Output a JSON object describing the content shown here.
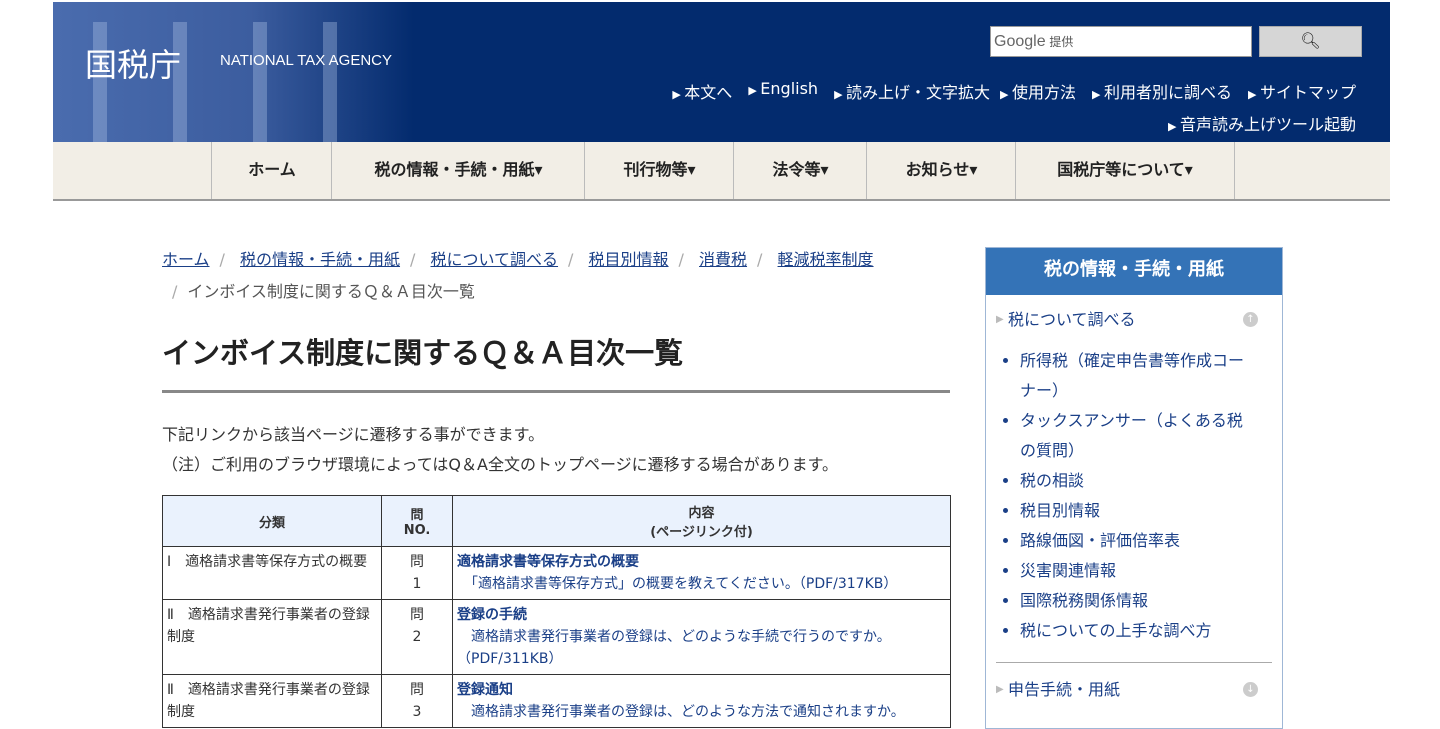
{
  "header": {
    "logo": "国税庁",
    "logo_en": "NATIONAL TAX AGENCY",
    "search_brand": "Google",
    "search_suffix": "提供",
    "search_icon": "search-icon",
    "util_links": [
      "本文へ",
      "English",
      "読み上げ・文字拡大",
      "使用方法",
      "利用者別に調べる",
      "サイトマップ"
    ],
    "util_link2": "音声読み上げツール起動"
  },
  "nav": [
    "ホーム",
    "税の情報・手続・用紙▾",
    "刊行物等▾",
    "法令等▾",
    "お知らせ▾",
    "国税庁等について▾"
  ],
  "breadcrumb": [
    "ホーム",
    "税の情報・手続・用紙",
    "税について調べる",
    "税目別情報",
    "消費税",
    "軽減税率制度"
  ],
  "breadcrumb_current": "インボイス制度に関するＱ＆Ａ目次一覧",
  "page_title": "インボイス制度に関するＱ＆Ａ目次一覧",
  "intro": [
    "下記リンクから該当ページに遷移する事ができます。",
    "（注）ご利用のブラウザ環境によってはQ＆A全文のトップページに遷移する場合があります。"
  ],
  "table": {
    "headers": [
      "分類",
      "問\nNO.",
      "内容\n(ページリンク付)"
    ],
    "rows": [
      {
        "category": "Ⅰ　適格請求書等保存方式の概要",
        "no": "問\n1",
        "title": "適格請求書等保存方式の概要",
        "desc": "　「適格請求書等保存方式」の概要を教えてください。（PDF/317KB）"
      },
      {
        "category": "Ⅱ　適格請求書発行事業者の登録制度",
        "no": "問\n2",
        "title": "登録の手続",
        "desc": "　適格請求書発行事業者の登録は、どのような手続で行うのですか。（PDF/311KB）"
      },
      {
        "category": "Ⅱ　適格請求書発行事業者の登録制度",
        "no": "問\n3",
        "title": "登録通知",
        "desc": "　適格請求書発行事業者の登録は、どのような方法で通知されますか。"
      }
    ]
  },
  "sidebar": {
    "title": "税の情報・手続・用紙",
    "section1": "税について調べる",
    "items": [
      "所得税（確定申告書等作成コーナー）",
      "タックスアンサー（よくある税の質問）",
      "税の相談",
      "税目別情報",
      "路線価図・評価倍率表",
      "災害関連情報",
      "国際税務関係情報",
      "税についての上手な調べ方"
    ],
    "section2": "申告手続・用紙"
  }
}
